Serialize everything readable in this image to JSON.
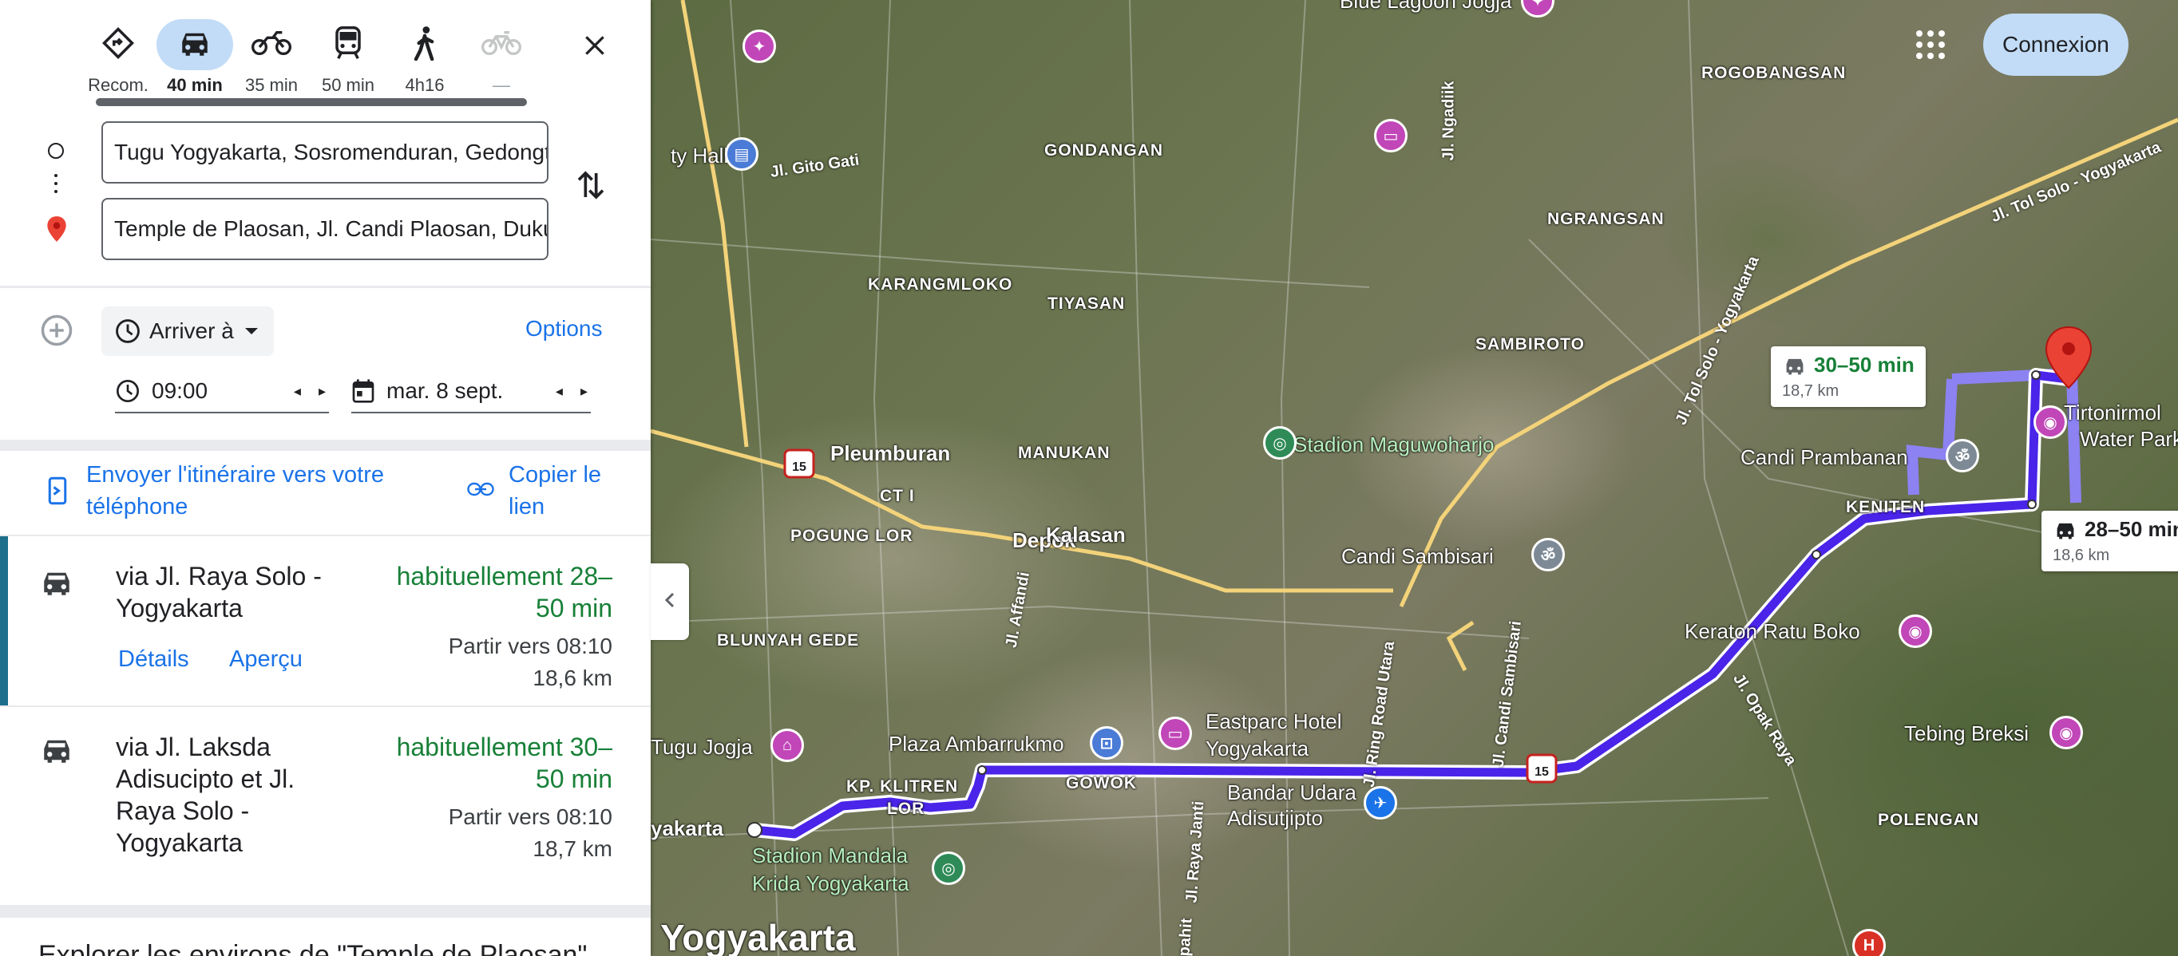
{
  "modes": [
    {
      "label": "Recom.",
      "icon": "directions-diamond-icon"
    },
    {
      "label": "40 min",
      "icon": "car-icon",
      "selected": true
    },
    {
      "label": "35 min",
      "icon": "motorcycle-icon"
    },
    {
      "label": "50 min",
      "icon": "transit-icon"
    },
    {
      "label": "4h16",
      "icon": "walk-icon"
    },
    {
      "label": "—",
      "icon": "bicycle-icon",
      "disabled": true
    }
  ],
  "origin": {
    "value": "Tugu Yogyakarta, Sosromenduran, Gedongtengen"
  },
  "destination": {
    "value": "Temple de Plaosan, Jl. Candi Plaosan, Dukuh"
  },
  "controls": {
    "arrive_label": "Arriver à",
    "options_label": "Options",
    "time_value": "09:00",
    "date_value": "mar. 8 sept."
  },
  "share": {
    "send_line1": "Envoyer l'itinéraire vers votre",
    "send_line2": "téléphone",
    "copy_line1": "Copier le",
    "copy_line2": "lien"
  },
  "routes": [
    {
      "via_lines": [
        "via Jl. Raya Solo -",
        "Yogyakarta"
      ],
      "usual_lines": [
        "habituellement 28–",
        "50 min"
      ],
      "depart": "Partir vers 08:10",
      "distance": "18,6 km",
      "details_label": "Détails",
      "preview_label": "Aperçu"
    },
    {
      "via_lines": [
        "via Jl. Laksda",
        "Adisucipto et Jl.",
        "Raya Solo -",
        "Yogyakarta"
      ],
      "usual_lines": [
        "habituellement 30–",
        "50 min"
      ],
      "depart": "Partir vers 08:10",
      "distance": "18,7 km"
    }
  ],
  "explore_text": "Explorer les environs de \"Temple de Plaosan\"",
  "map": {
    "signin_label": "Connexion",
    "route_cards": [
      {
        "time": "30–50 min",
        "distance": "18,7 km",
        "color": "#188038"
      },
      {
        "time": "28–50 min",
        "distance": "18,6 km",
        "color": "#202124"
      }
    ],
    "area_labels": [
      "ROGOBANGSAN",
      "GONDANGAN",
      "NGRANGSAN",
      "KARANGMLOKO",
      "TIYASAN",
      "SAMBIROTO",
      "MANUKAN",
      "CT I",
      "POGUNG LOR",
      "KENITEN",
      "BLUNYAH GEDE",
      "KP. KLITREN",
      "LOR",
      "GOWOK",
      "POLENGAN"
    ],
    "place_labels": [
      "Blue Lagoon Jogja",
      "ty Hall",
      "Pleumburan",
      "Depok",
      "Stadion Maguwoharjo",
      "Candi Prambanan",
      "Tirtonirmol",
      "Water Park",
      "Kalasan",
      "Candi Sambisari",
      "Keraton Ratu Boko",
      "Tebing Breksi",
      "Tugu Jogja",
      "Plaza Ambarrukmo",
      "Eastparc Hotel",
      "Yogyakarta",
      "Bandar Udara",
      "Adisutjipto",
      "yakarta",
      "Stadion Mandala",
      "Krida Yogyakarta",
      "Yogyakarta"
    ],
    "road_labels": [
      "Jl. Gito Gati",
      "Jl. Ngadiik",
      "Jl. Tol Solo - Yogyakarta",
      "Jl. Tol Solo - Yogyakarta",
      "Jl. Affandi",
      "Jl. Ring Road Utara",
      "Jl. Candi Sambisari",
      "Jl. Opak Raya",
      "Jl. Raya Janti",
      "apahit"
    ],
    "route_color": "#4a24e8",
    "alt_route_color": "#8c82f2"
  }
}
